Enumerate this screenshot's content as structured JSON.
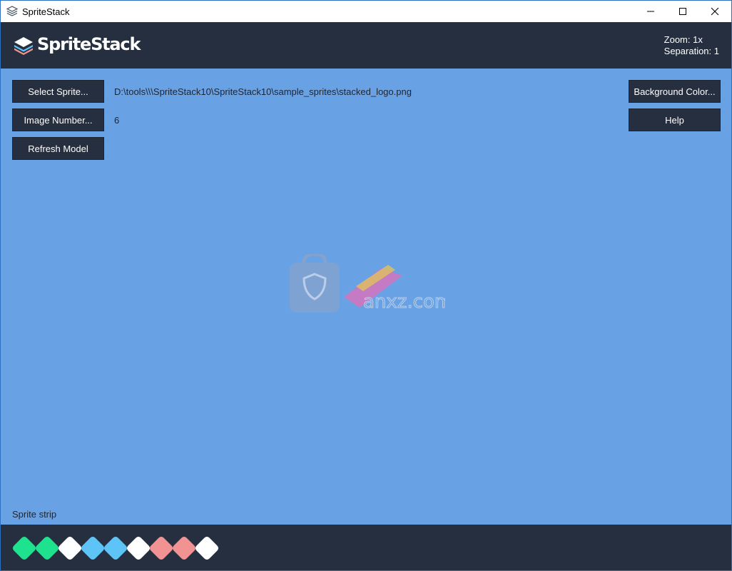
{
  "window": {
    "title": "SpriteStack",
    "controls": {
      "minimize": "minimize-icon",
      "maximize": "maximize-icon",
      "close": "close-icon"
    }
  },
  "header": {
    "logo_text": "SpriteStack",
    "zoom_text": "Zoom: 1x",
    "separation_text": "Separation: 1"
  },
  "toolbar": {
    "select_sprite_label": "Select Sprite...",
    "sprite_path": "D:\\tools\\\\\\SpriteStack10\\SpriteStack10\\sample_sprites\\stacked_logo.png",
    "image_number_label": "Image Number...",
    "image_number_value": "6",
    "refresh_label": "Refresh Model",
    "background_color_label": "Background Color...",
    "help_label": "Help"
  },
  "main": {
    "background_color": "#68a2e4",
    "sprite_strip_label": "Sprite strip"
  },
  "sprite_strip": {
    "frames": [
      {
        "color": "#1fe28f"
      },
      {
        "color": "#1fe28f"
      },
      {
        "color": "#ffffff"
      },
      {
        "color": "#5ec4f7"
      },
      {
        "color": "#5ec4f7"
      },
      {
        "color": "#ffffff"
      },
      {
        "color": "#f29393"
      },
      {
        "color": "#f29393"
      },
      {
        "color": "#ffffff"
      }
    ]
  },
  "watermark": {
    "text": "anxz.com"
  },
  "colors": {
    "dark_panel": "#252f3f",
    "accent_blue": "#68a2e4"
  }
}
